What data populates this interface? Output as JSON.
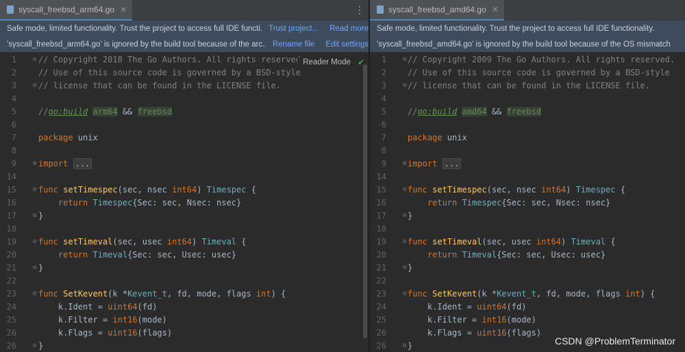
{
  "left": {
    "tab_label": "syscall_freebsd_arm64.go",
    "banner1_msg": "Safe mode, limited functionality. Trust the project to access full IDE functi...",
    "banner1_link1": "Trust project...",
    "banner1_link2": "Read more",
    "banner2_msg": "'syscall_freebsd_arm64.go' is ignored by the build tool because of the arc...",
    "banner2_link1": "Rename file",
    "banner2_link2": "Edit settings",
    "reader_mode": "Reader Mode",
    "copyright": "// Copyright 2018 The Go Authors. All rights reserved.",
    "arch": "arm64"
  },
  "right": {
    "tab_label": "syscall_freebsd_amd64.go",
    "banner1_msg": "Safe mode, limited functionality. Trust the project to access full IDE functionality.",
    "banner2_msg": "'syscall_freebsd_amd64.go' is ignored by the build tool because of the OS mismatch",
    "copyright": "// Copyright 2009 The Go Authors. All rights reserved.",
    "arch": "amd64"
  },
  "code": {
    "line_numbers": [
      "1",
      "2",
      "3",
      "4",
      "5",
      "6",
      "7",
      "8",
      "9",
      "14",
      "15",
      "16",
      "17",
      "18",
      "19",
      "20",
      "21",
      "22",
      "23",
      "24",
      "25",
      "26"
    ],
    "license1": "// Use of this source code is governed by a BSD-style",
    "license2": "// license that can be found in the LICENSE file.",
    "build_prefix": "//",
    "build_tag": "go:build",
    "and_op": " && ",
    "os": "freebsd",
    "package_kw": "package",
    "package_name": " unix",
    "import_kw": "import",
    "import_fold": "...",
    "func_kw": "func",
    "return_kw": "return",
    "setTimespec": "setTimespec",
    "setTimespec_params": "(sec, nsec ",
    "int64": "int64",
    "close_paren": ") ",
    "Timespec": "Timespec",
    "open_brace": " {",
    "timespec_return_rest": "{Sec: sec, Nsec: nsec}",
    "close_brace": "}",
    "setTimeval": "setTimeval",
    "setTimeval_params": "(sec, usec ",
    "Timeval": "Timeval",
    "timeval_return_rest": "{Sec: sec, Usec: usec}",
    "SetKevent": "SetKevent",
    "kevent_params_a": "(k *",
    "Kevent_t": "Kevent_t",
    "kevent_params_b": ", fd, mode, flags ",
    "int": "int",
    "kevent_close": ") {",
    "k_ident": "k.Ident",
    "k_filter": "k.Filter",
    "k_flags": "k.Flags",
    "assign": " = ",
    "uint64": "uint64",
    "int16": "int16",
    "uint16": "uint16",
    "arg_fd": "(fd)",
    "arg_mode": "(mode)",
    "arg_flags": "(flags)"
  },
  "watermark": "CSDN @ProblemTerminator"
}
